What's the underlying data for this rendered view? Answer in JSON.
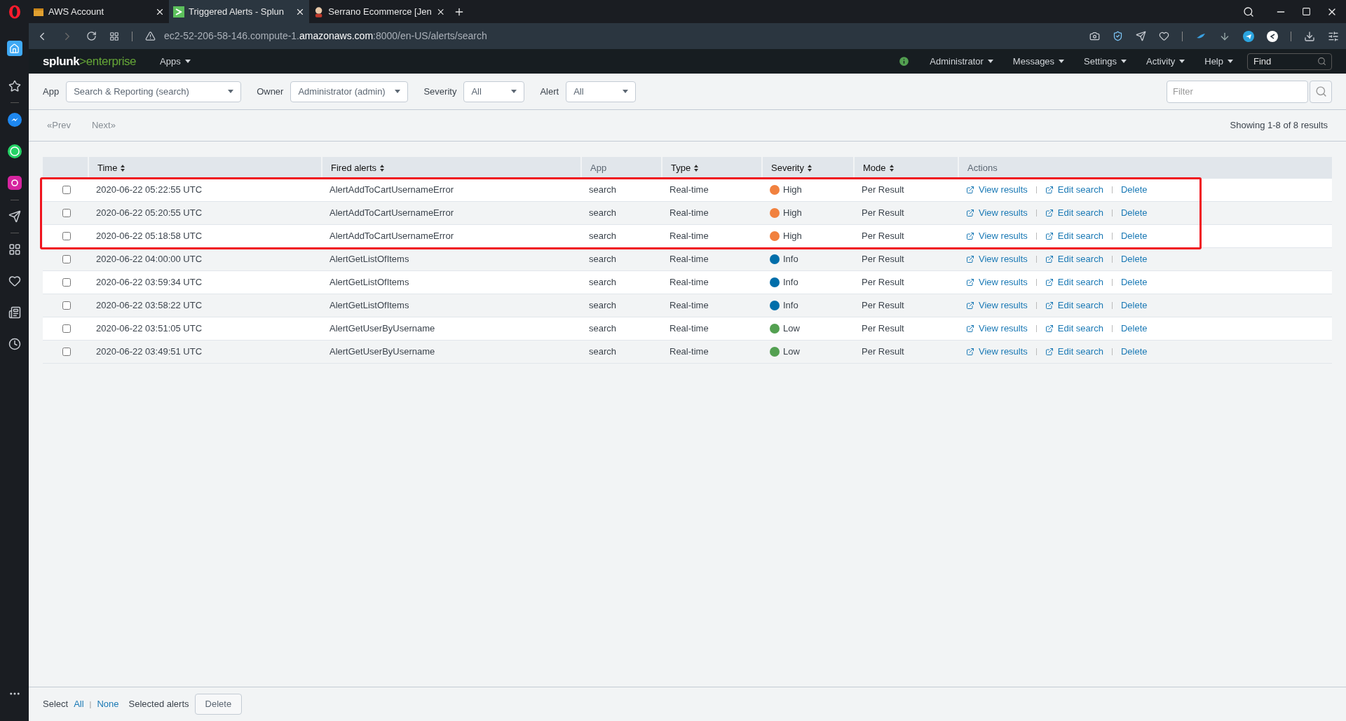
{
  "browser": {
    "tabs": [
      {
        "label": "AWS Account",
        "kind": "box",
        "selected": false
      },
      {
        "label": "Triggered Alerts - Splun",
        "kind": "splunk",
        "selected": true
      },
      {
        "label": "Serrano Ecommerce [Jen",
        "kind": "person",
        "selected": false
      }
    ],
    "url_host_prefix": "ec2-52-206-58-146.compute-1.",
    "url_host_domain": "amazonaws.com",
    "url_rest": ":8000/en-US/alerts/search"
  },
  "splunk_bar": {
    "logo_left": "splunk",
    "logo_right": ">enterprise",
    "apps_menu": "Apps",
    "menus": [
      "Administrator",
      "Messages",
      "Settings",
      "Activity",
      "Help"
    ],
    "find_placeholder": "Find"
  },
  "filters": [
    {
      "label": "App",
      "value": "Search & Reporting (search)"
    },
    {
      "label": "Owner",
      "value": "Administrator (admin)"
    },
    {
      "label": "Severity",
      "value": "All"
    },
    {
      "label": "Alert",
      "value": "All"
    }
  ],
  "filter_placeholder": "Filter",
  "pager": {
    "prev": "«Prev",
    "next": "Next»",
    "summary": "Showing 1-8 of 8 results"
  },
  "table": {
    "columns": [
      {
        "label": "Time",
        "sortable": true
      },
      {
        "label": "Fired alerts",
        "sortable": true
      },
      {
        "label": "App",
        "sortable": false
      },
      {
        "label": "Type",
        "sortable": true
      },
      {
        "label": "Severity",
        "sortable": true
      },
      {
        "label": "Mode",
        "sortable": true
      },
      {
        "label": "Actions",
        "sortable": false
      }
    ],
    "rows": [
      {
        "time": "2020-06-22 05:22:55 UTC",
        "alert": "AlertAddToCartUsernameError",
        "app": "search",
        "type": "Real-time",
        "severity": "High",
        "color": "#f1813f",
        "mode": "Per Result",
        "checked": false,
        "highlighted": true,
        "actions": [
          "View results",
          "Edit search",
          "Delete"
        ]
      },
      {
        "time": "2020-06-22 05:20:55 UTC",
        "alert": "AlertAddToCartUsernameError",
        "app": "search",
        "type": "Real-time",
        "severity": "High",
        "color": "#f1813f",
        "mode": "Per Result",
        "checked": false,
        "highlighted": true,
        "actions": [
          "View results",
          "Edit search",
          "Delete"
        ]
      },
      {
        "time": "2020-06-22 05:18:58 UTC",
        "alert": "AlertAddToCartUsernameError",
        "app": "search",
        "type": "Real-time",
        "severity": "High",
        "color": "#f1813f",
        "mode": "Per Result",
        "checked": false,
        "highlighted": true,
        "actions": [
          "View results",
          "Edit search",
          "Delete"
        ]
      },
      {
        "time": "2020-06-22 04:00:00 UTC",
        "alert": "AlertGetListOfItems",
        "app": "search",
        "type": "Real-time",
        "severity": "Info",
        "color": "#006eaa",
        "mode": "Per Result",
        "checked": false,
        "highlighted": false,
        "actions": [
          "View results",
          "Edit search",
          "Delete"
        ]
      },
      {
        "time": "2020-06-22 03:59:34 UTC",
        "alert": "AlertGetListOfItems",
        "app": "search",
        "type": "Real-time",
        "severity": "Info",
        "color": "#006eaa",
        "mode": "Per Result",
        "checked": false,
        "highlighted": false,
        "actions": [
          "View results",
          "Edit search",
          "Delete"
        ]
      },
      {
        "time": "2020-06-22 03:58:22 UTC",
        "alert": "AlertGetListOfItems",
        "app": "search",
        "type": "Real-time",
        "severity": "Info",
        "color": "#006eaa",
        "mode": "Per Result",
        "checked": false,
        "highlighted": false,
        "actions": [
          "View results",
          "Edit search",
          "Delete"
        ]
      },
      {
        "time": "2020-06-22 03:51:05 UTC",
        "alert": "AlertGetUserByUsername",
        "app": "search",
        "type": "Real-time",
        "severity": "Low",
        "color": "#53a051",
        "mode": "Per Result",
        "checked": false,
        "highlighted": false,
        "actions": [
          "View results",
          "Edit search",
          "Delete"
        ]
      },
      {
        "time": "2020-06-22 03:49:51 UTC",
        "alert": "AlertGetUserByUsername",
        "app": "search",
        "type": "Real-time",
        "severity": "Low",
        "color": "#53a051",
        "mode": "Per Result",
        "checked": false,
        "highlighted": false,
        "actions": [
          "View results",
          "Edit search",
          "Delete"
        ]
      }
    ]
  },
  "footer": {
    "select_label": "Select",
    "all": "All",
    "separator": "|",
    "none": "None",
    "selected_label": "Selected alerts",
    "delete": "Delete"
  }
}
